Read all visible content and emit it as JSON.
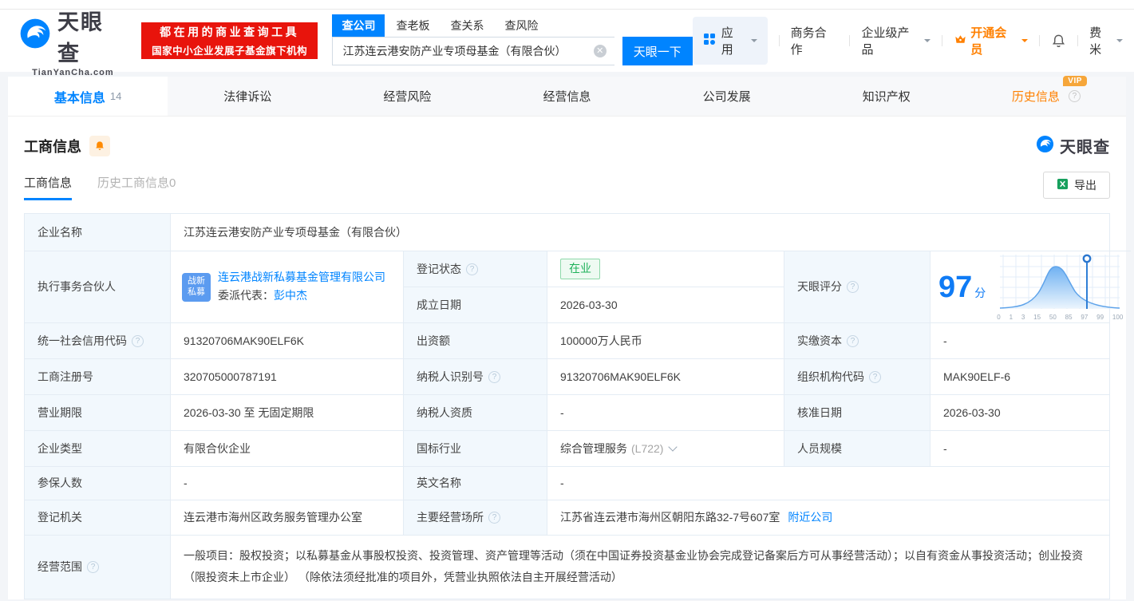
{
  "header": {
    "logo": {
      "name": "天眼查",
      "domain": "TianYanCha.com"
    },
    "slogan": {
      "line1": "都在用的商业查询工具",
      "line2": "国家中小企业发展子基金旗下机构"
    },
    "search": {
      "tabs": [
        {
          "label": "查公司"
        },
        {
          "label": "查老板"
        },
        {
          "label": "查关系"
        },
        {
          "label": "查风险"
        }
      ],
      "value": "江苏连云港安防产业专项母基金（有限合伙）",
      "button": "天眼一下"
    },
    "nav": {
      "apps": "应用",
      "cooperation": "商务合作",
      "enterprise": "企业级产品",
      "vip": "开通会员",
      "user": "费米"
    }
  },
  "page_tabs": {
    "items": [
      {
        "label": "基本信息",
        "count": "14"
      },
      {
        "label": "法律诉讼"
      },
      {
        "label": "经营风险"
      },
      {
        "label": "经营信息"
      },
      {
        "label": "公司发展"
      },
      {
        "label": "知识产权"
      },
      {
        "label": "历史信息",
        "badge": "VIP"
      }
    ]
  },
  "section": {
    "title": "工商信息",
    "subtab_current": "工商信息",
    "subtab_history": "历史工商信息0",
    "export": "导出",
    "watermark": "天眼查"
  },
  "table": {
    "company_name": {
      "label": "企业名称",
      "value": "江苏连云港安防产业专项母基金（有限合伙）"
    },
    "partner": {
      "label": "执行事务合伙人",
      "avatar": "战新私募",
      "company": "连云港战新私募基金管理有限公司",
      "delegate_label": "委派代表：",
      "delegate": "彭中杰"
    },
    "reg_status": {
      "label": "登记状态",
      "value": "在业"
    },
    "establish_date": {
      "label": "成立日期",
      "value": "2026-03-30"
    },
    "score": {
      "label": "天眼评分",
      "value": "97",
      "unit": "分",
      "ticks": [
        "0",
        "1",
        "3",
        "15",
        "50",
        "85",
        "97",
        "99",
        "100"
      ]
    },
    "rows": [
      {
        "c0": {
          "label": "统一社会信用代码",
          "value": "91320706MAK90ELF6K"
        },
        "c1": {
          "label": "出资额",
          "value": "100000万人民币"
        },
        "c2": {
          "label": "实缴资本",
          "value": "-"
        }
      },
      {
        "c0": {
          "label": "工商注册号",
          "value": "320705000787191"
        },
        "c1": {
          "label": "纳税人识别号",
          "value": "91320706MAK90ELF6K"
        },
        "c2": {
          "label": "组织机构代码",
          "value": "MAK90ELF-6"
        }
      },
      {
        "c0": {
          "label": "营业期限",
          "value": "2026-03-30 至 无固定期限"
        },
        "c1": {
          "label": "纳税人资质",
          "value": "-"
        },
        "c2": {
          "label": "核准日期",
          "value": "2026-03-30"
        }
      },
      {
        "c0": {
          "label": "企业类型",
          "value": "有限合伙企业"
        },
        "c1": {
          "label": "国标行业",
          "value": "综合管理服务",
          "note": "(L722)"
        },
        "c2": {
          "label": "人员规模",
          "value": "-"
        }
      }
    ],
    "insured": {
      "label": "参保人数",
      "value": "-"
    },
    "english_name": {
      "label": "英文名称",
      "value": "-"
    },
    "registry": {
      "label": "登记机关",
      "value": "连云港市海州区政务服务管理办公室"
    },
    "address": {
      "label": "主要经营场所",
      "value": "江苏省连云港市海州区朝阳东路32-7号607室",
      "link": "附近公司"
    },
    "scope": {
      "label": "经营范围",
      "value": "一般项目：股权投资；以私募基金从事股权投资、投资管理、资产管理等活动（须在中国证券投资基金业协会完成登记备案后方可从事经营活动）；以自有资金从事投资活动；创业投资（限投资未上市企业） （除依法须经批准的项目外，凭营业执照依法自主开展经营活动）"
    }
  },
  "colors": {
    "primary": "#0084ff",
    "red": "#e8140c",
    "orange": "#ff8000",
    "green": "#1eb15a"
  }
}
